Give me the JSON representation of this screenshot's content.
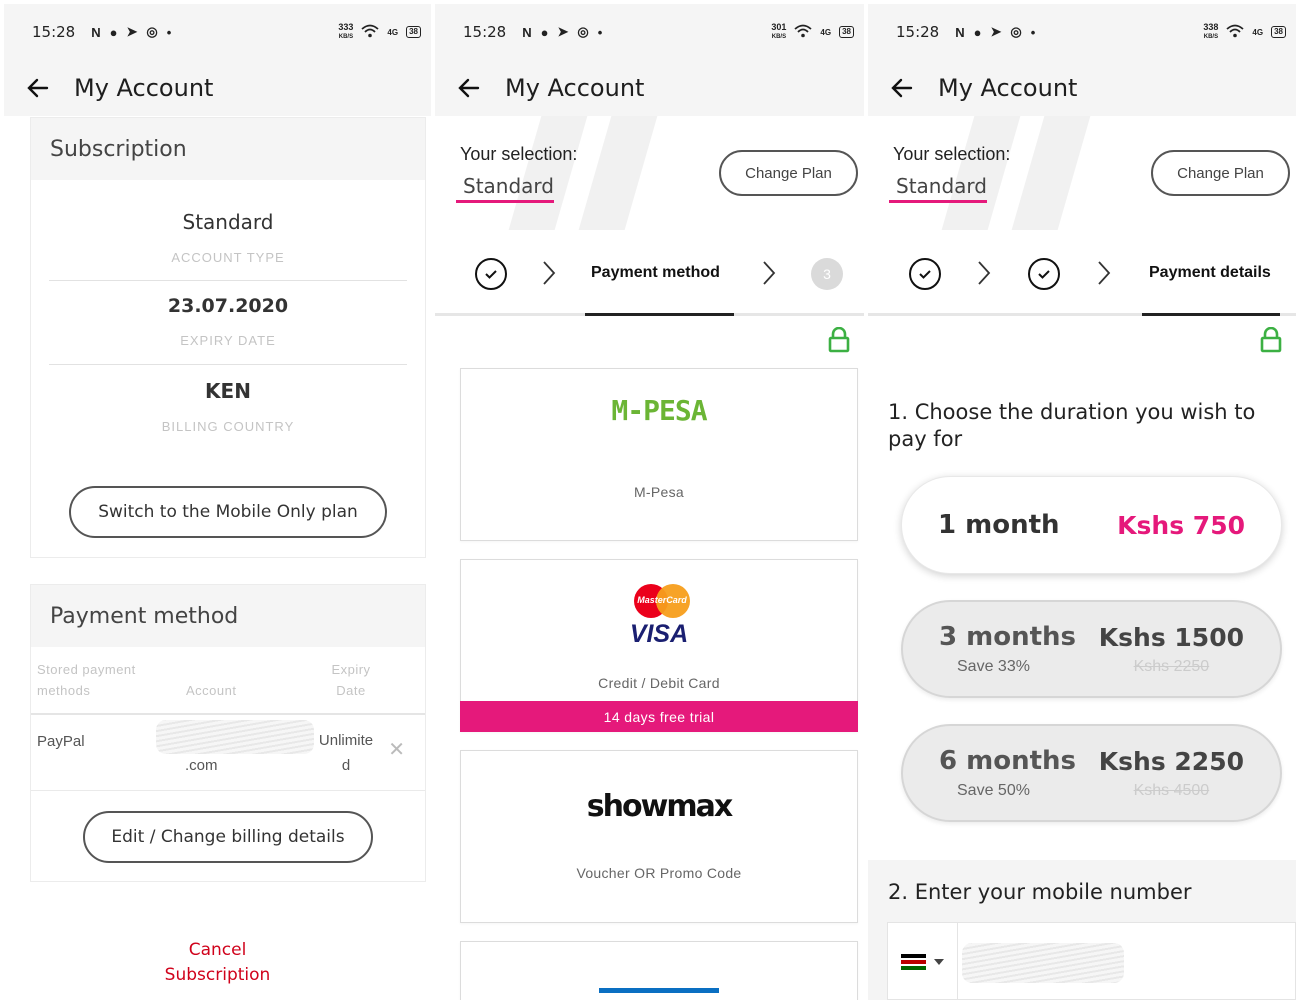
{
  "status_bar": {
    "time": "15:28",
    "panels": [
      {
        "speed_top": "333",
        "speed_bottom": "KB/S",
        "battery": "38"
      },
      {
        "speed_top": "301",
        "speed_bottom": "KB/S",
        "battery": "38"
      },
      {
        "speed_top": "338",
        "speed_bottom": "KB/S",
        "battery": "38"
      }
    ],
    "network": "4G"
  },
  "header": {
    "title": "My Account"
  },
  "panel1": {
    "subscription": {
      "heading": "Subscription",
      "account_type_value": "Standard",
      "account_type_label": "ACCOUNT TYPE",
      "expiry_value": "23.07.2020",
      "expiry_label": "EXPIRY DATE",
      "country_value": "KEN",
      "country_label": "BILLING COUNTRY",
      "switch_button": "Switch to the Mobile Only plan"
    },
    "payment_method": {
      "heading": "Payment method",
      "col_methods": "Stored payment methods",
      "col_account": "Account",
      "col_expiry": "Expiry Date",
      "row": {
        "method": "PayPal",
        "account": ".com",
        "expiry": "Unlimited"
      },
      "edit_button": "Edit / Change billing details"
    },
    "cancel_link": "Cancel Subscription"
  },
  "selection": {
    "label": "Your selection:",
    "value": "Standard",
    "change_button": "Change Plan"
  },
  "panel2": {
    "step_current": "Payment method",
    "step_next_number": "3",
    "options": [
      {
        "name": "M-Pesa",
        "logo_text": "M-PESA"
      },
      {
        "name": "Credit / Debit Card",
        "logo_mc": "MasterCard",
        "logo_visa": "VISA",
        "badge": "14 days free trial"
      },
      {
        "name": "Voucher OR Promo Code",
        "logo_text": "showmax"
      }
    ]
  },
  "panel3": {
    "step_current": "Payment details",
    "question1": "1. Choose the duration you wish to pay for",
    "durations": [
      {
        "name": "1 month",
        "price": "Kshs 750",
        "save": "",
        "old_price": ""
      },
      {
        "name": "3 months",
        "price": "Kshs 1500",
        "save": "Save 33%",
        "old_price": "Kshs 2250"
      },
      {
        "name": "6 months",
        "price": "Kshs 2250",
        "save": "Save 50%",
        "old_price": "Kshs 4500"
      }
    ],
    "question2": "2. Enter your mobile number"
  },
  "colors": {
    "accent_pink": "#e5197b",
    "cancel_red": "#d0021b",
    "lock_green": "#3cb043",
    "mpesa_green": "#6bb535"
  }
}
